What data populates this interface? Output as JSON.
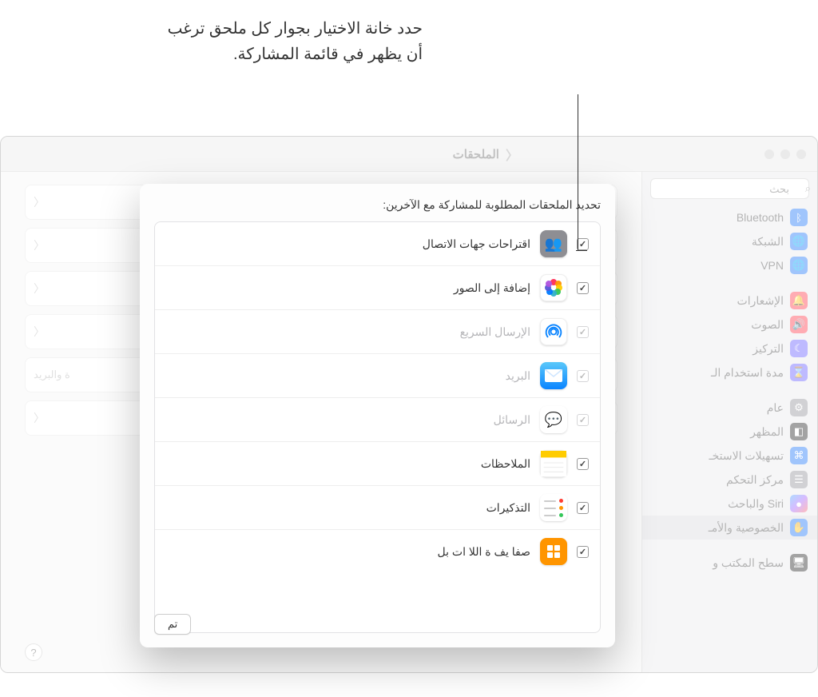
{
  "callout": "حدد خانة الاختيار بجوار كل ملحق ترغب أن يظهر في قائمة المشاركة.",
  "window": {
    "title": "الملحقات",
    "search_placeholder": "بحث"
  },
  "sidebar": {
    "items": [
      {
        "label": "Bluetooth",
        "icon": "bt"
      },
      {
        "label": "الشبكة",
        "icon": "net"
      },
      {
        "label": "VPN",
        "icon": "vpn"
      },
      {
        "gap": true
      },
      {
        "label": "الإشعارات",
        "icon": "notif"
      },
      {
        "label": "الصوت",
        "icon": "sound"
      },
      {
        "label": "التركيز",
        "icon": "focus"
      },
      {
        "label": "مدة استخدام الـ",
        "icon": "st"
      },
      {
        "gap": true
      },
      {
        "label": "عام",
        "icon": "gen"
      },
      {
        "label": "المظهر",
        "icon": "app"
      },
      {
        "label": "تسهيلات الاستخـ",
        "icon": "acc"
      },
      {
        "label": "مركز التحكم",
        "icon": "cc"
      },
      {
        "label": "Siri والباحث",
        "icon": "siri"
      },
      {
        "label": "الخصوصية والأمـ",
        "icon": "priv",
        "selected": true
      },
      {
        "gap": true
      },
      {
        "label": "سطح المكتب و",
        "icon": "desk"
      }
    ]
  },
  "content": {
    "peek_text": "ة والبريد"
  },
  "modal": {
    "title": "تحديد الملحقات المطلوبة للمشاركة مع الآخرين:",
    "done": "تم",
    "items": [
      {
        "label": "اقتراحات جهات الاتصال",
        "icon": "contacts",
        "checked": true,
        "enabled": true
      },
      {
        "label": "إضافة إلى الصور",
        "icon": "photos",
        "checked": true,
        "enabled": true
      },
      {
        "label": "الإرسال السريع",
        "icon": "airdrop",
        "checked": true,
        "enabled": false
      },
      {
        "label": "البريد",
        "icon": "mail",
        "checked": true,
        "enabled": false
      },
      {
        "label": "الرسائل",
        "icon": "messages",
        "checked": true,
        "enabled": false
      },
      {
        "label": "الملاحظات",
        "icon": "notes",
        "checked": true,
        "enabled": true
      },
      {
        "label": "التذكيرات",
        "icon": "reminders",
        "checked": true,
        "enabled": true
      },
      {
        "label": "صفا  يف  ة  اللا  ات  بل",
        "icon": "safari",
        "checked": true,
        "enabled": true
      }
    ]
  }
}
